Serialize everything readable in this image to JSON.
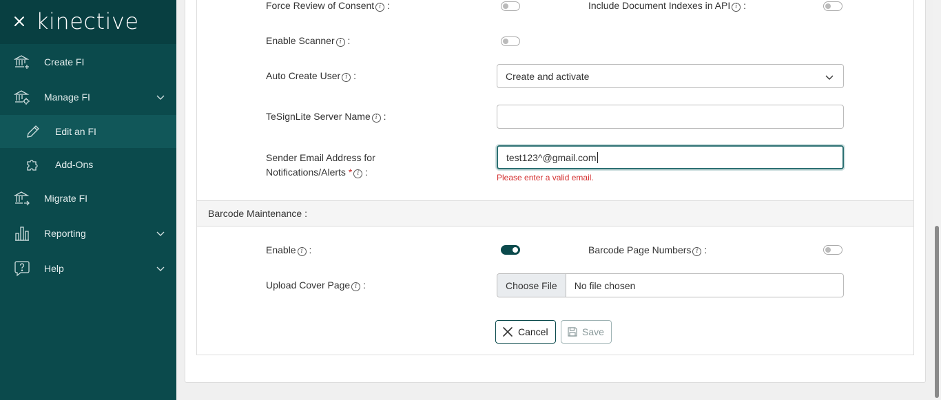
{
  "app": {
    "logo": "kinective"
  },
  "sidebar": {
    "items": [
      {
        "label": "Create FI",
        "icon": "bank-plus-icon"
      },
      {
        "label": "Manage FI",
        "icon": "bank-gear-icon"
      },
      {
        "label": "Edit an FI",
        "icon": "pencil-icon"
      },
      {
        "label": "Add-Ons",
        "icon": "puzzle-icon"
      },
      {
        "label": "Migrate FI",
        "icon": "bank-arrow-icon"
      },
      {
        "label": "Reporting",
        "icon": "bar-chart-icon"
      },
      {
        "label": "Help",
        "icon": "help-bubble-icon"
      }
    ]
  },
  "form": {
    "force_review_label": "Force Review of Consent",
    "include_doc_indexes_label": "Include Document Indexes in API",
    "enable_scanner_label": "Enable Scanner",
    "auto_create_user_label": "Auto Create User",
    "auto_create_user_value": "Create and activate",
    "tesign_server_label": "TeSignLite Server Name",
    "tesign_server_value": "",
    "sender_email_label_line1": "Sender Email Address for",
    "sender_email_label_line2": "Notifications/Alerts",
    "sender_email_value": "test123^@gmail.com",
    "sender_email_error": "Please enter a valid email.",
    "colon": ":",
    "required_mark": "*",
    "info_glyph": "i"
  },
  "barcode": {
    "section_title": "Barcode Maintenance :",
    "enable_label": "Enable",
    "enable_on": true,
    "page_numbers_label": "Barcode Page Numbers",
    "page_numbers_on": false,
    "upload_cover_label": "Upload Cover Page",
    "choose_file": "Choose File",
    "no_file": "No file chosen"
  },
  "actions": {
    "cancel": "Cancel",
    "save": "Save"
  },
  "colors": {
    "sidebar_bg": "#0b4a4c",
    "accent": "#0b4a4c",
    "error": "#d32f2f"
  }
}
